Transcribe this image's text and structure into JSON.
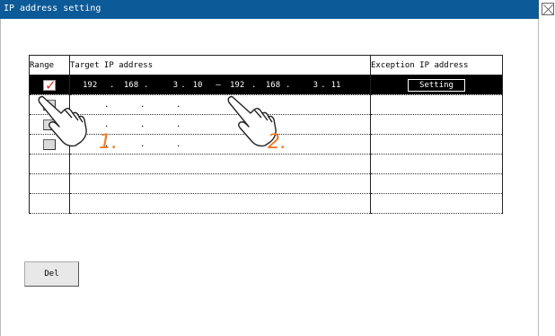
{
  "window": {
    "title": "IP address setting"
  },
  "table": {
    "headers": {
      "range": "Range",
      "target": "Target IP address",
      "exception": "Exception IP address"
    },
    "rows": [
      {
        "checked": true,
        "start": [
          "192",
          "168",
          "3",
          "10"
        ],
        "dash": "—",
        "end": [
          "192",
          "168",
          "3",
          "11"
        ],
        "exception": "Setting",
        "selected": true
      },
      {
        "checked": false,
        "placeholder": [
          ".",
          ".",
          "."
        ]
      },
      {
        "checked": false,
        "placeholder": [
          ".",
          ".",
          "."
        ]
      },
      {
        "checked": false,
        "placeholder": [
          ".",
          ".",
          "."
        ]
      }
    ],
    "empty_rows": 3
  },
  "buttons": {
    "del": "Del"
  },
  "annotations": {
    "step1": "1.",
    "step2": "2."
  },
  "colors": {
    "title_bar": "#0c5a98",
    "check": "#e03020",
    "annotation": "#f07a2a"
  },
  "icons": [
    "close-icon",
    "checkmark-icon",
    "pointing-hand-icon"
  ]
}
